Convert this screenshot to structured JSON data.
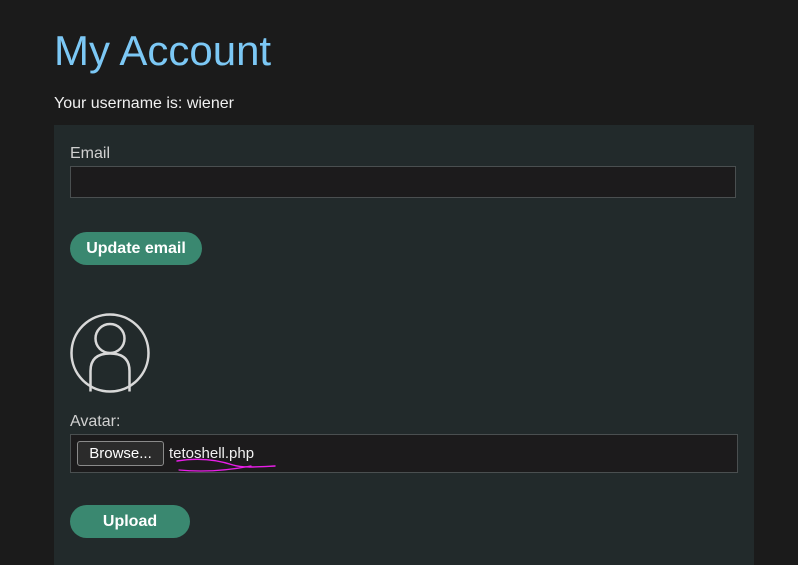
{
  "header": {
    "title": "My Account",
    "username_text": "Your username is: wiener"
  },
  "email_form": {
    "label": "Email",
    "value": "",
    "button_label": "Update email"
  },
  "avatar_form": {
    "label": "Avatar:",
    "browse_label": "Browse...",
    "file_name": "tetoshell.php",
    "button_label": "Upload"
  },
  "colors": {
    "background": "#1b1b1b",
    "panel": "#222a2b",
    "title": "#7cc8f5",
    "button": "#3a8870",
    "annotation": "#e81ee8"
  },
  "icons": {
    "avatar": "user-placeholder-icon"
  }
}
